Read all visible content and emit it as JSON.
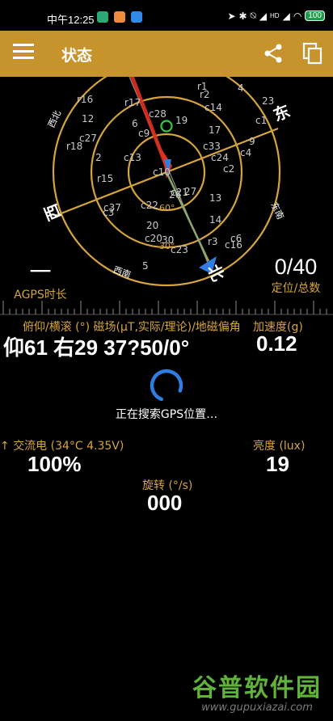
{
  "status_bar": {
    "time": "中午12:25",
    "battery": "100",
    "signal_tag": "HD"
  },
  "app_bar": {
    "title": "状态"
  },
  "sky_plot": {
    "directions": {
      "north": "北",
      "east": "东",
      "south": "南",
      "west": "西",
      "northwest": "西北",
      "southeast": "东南",
      "southwest": "西南"
    },
    "elevation_labels": [
      "60°",
      "30°"
    ],
    "satellite_labels": [
      "r1",
      "r2",
      "4",
      "23",
      "r16",
      "12",
      "r17",
      "c28",
      "19",
      "c14",
      "c1",
      "6",
      "c9",
      "17",
      "c27",
      "r18",
      "2",
      "c13",
      "c33",
      "9",
      "c4",
      "c24",
      "c2",
      "r15",
      "c10",
      "c21",
      "26",
      "27",
      "c37",
      "13",
      "c3",
      "c22",
      "20",
      "14",
      "c20",
      "r3",
      "c6",
      "c16",
      "c23",
      "5",
      "30"
    ]
  },
  "agps": {
    "value": "一",
    "label": "AGPS时长"
  },
  "position": {
    "value": "0/40",
    "label": "定位/总数"
  },
  "orientation": {
    "label": "俯仰/横滚 (°) 磁场(µT,实际/理论)/地磁偏角",
    "value": "仰61 右29  37?50/0°"
  },
  "acceleration": {
    "label": "加速度(g)",
    "value": "0.12"
  },
  "searching_text": "正在搜索GPS位置…",
  "power": {
    "label": "交流电 (34°C 4.35V)",
    "value": "100%"
  },
  "brightness": {
    "label": "亮度 (lux)",
    "value": "19"
  },
  "rotation": {
    "label": "旋转 (°/s)",
    "value": "000"
  },
  "watermark": {
    "title": "谷普软件园",
    "url": "www.gupuxiazai.com"
  },
  "colors": {
    "accent": "#c7932c",
    "ring": "#d6a43c",
    "label": "#d6a43c",
    "satellite": "#c8c8c8",
    "green_fix": "#2ecc40",
    "blue_arrow": "#2f7de1",
    "red_arrow": "#e0301e"
  }
}
